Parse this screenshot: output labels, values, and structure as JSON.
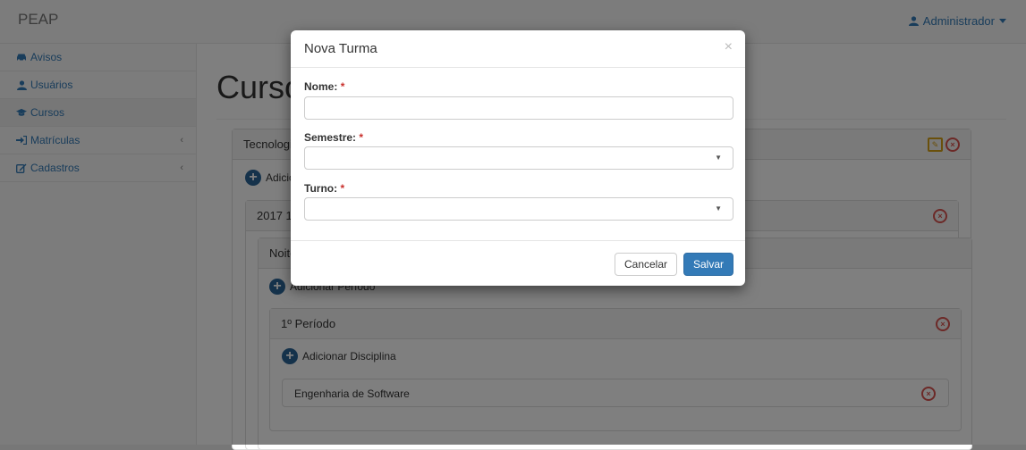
{
  "navbar": {
    "brand": "PEAP",
    "user_label": "Administrador"
  },
  "sidebar": {
    "items": [
      {
        "label": "Avisos",
        "icon": "car-icon"
      },
      {
        "label": "Usuários",
        "icon": "user-icon"
      },
      {
        "label": "Cursos",
        "icon": "graduation-cap-icon",
        "active": true
      },
      {
        "label": "Matrículas",
        "icon": "sign-in-icon",
        "has_children": true
      },
      {
        "label": "Cadastros",
        "icon": "edit-icon",
        "has_children": true
      }
    ]
  },
  "main": {
    "page_title": "Cursos",
    "course_panel": {
      "title": "Tecnologia"
    },
    "add_turma_label": "Adicionar Turma",
    "turma_panel": {
      "title": "2017 1"
    },
    "turno_panel": {
      "title": "Noite"
    },
    "add_period_label": "Adicionar Período",
    "period_panel": {
      "title": "1º Período"
    },
    "add_discipline_label": "Adicionar Disciplina",
    "discipline_panel": {
      "title": "Engenharia de Software"
    }
  },
  "modal": {
    "title": "Nova Turma",
    "close_glyph": "×",
    "fields": {
      "nome_label": "Nome:",
      "semestre_label": "Semestre:",
      "turno_label": "Turno:",
      "required_mark": "*"
    },
    "cancel_label": "Cancelar",
    "save_label": "Salvar"
  },
  "colors": {
    "primary": "#337ab7",
    "danger": "#d9534f",
    "warning": "#d4a017",
    "backdrop": "rgba(0,0,0,0.5)"
  }
}
